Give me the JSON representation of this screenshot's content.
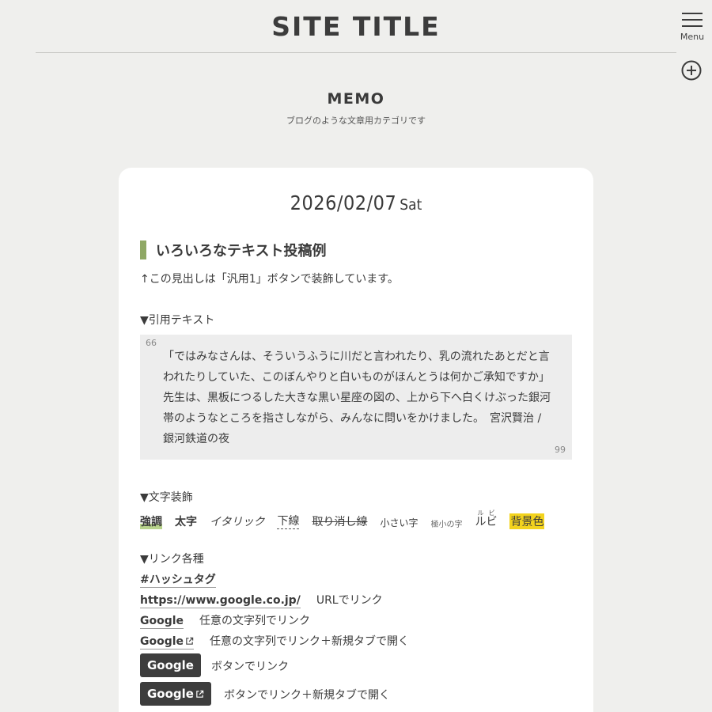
{
  "header": {
    "site_title": "SITE TITLE",
    "menu_label": "Menu"
  },
  "category": {
    "name": "MEMO",
    "description": "ブログのような文章用カテゴリです"
  },
  "post": {
    "date": "2026/02/07",
    "weekday": "Sat",
    "heading": "いろいろなテキスト投稿例",
    "heading_note": "↑この見出しは「汎用1」ボタンで装飾しています。",
    "quote_section_label": "▼引用テキスト",
    "quote_text": "「ではみなさんは、そういうふうに川だと言われたり、乳の流れたあとだと言われたりしていた、このぼんやりと白いものがほんとうは何かご承知ですか」先生は、黒板につるした大きな黒い星座の図の、上から下へ白くけぶった銀河帯のようなところを指さしながら、みんなに問いをかけました。　宮沢賢治 / 銀河鉄道の夜",
    "quote_open_mark": "66",
    "quote_close_mark": "99",
    "decoration_section_label": "▼文字装飾",
    "decorations": {
      "strong": "強調",
      "bold": "太字",
      "italic": "イタリック",
      "underline": "下線",
      "strike": "取り消し線",
      "small": "小さい字",
      "xsmall": "極小の字",
      "ruby_base": "ルビ",
      "ruby_text": "ルビ",
      "background": "背景色"
    },
    "link_section_label": "▼リンク各種",
    "links": {
      "hashtag": "#ハッシュタグ",
      "url": "https://www.google.co.jp/",
      "url_note": "URLでリンク",
      "text_link": "Google",
      "text_link_note": "任意の文字列でリンク",
      "text_link_newtab": "Google",
      "text_link_newtab_note": "任意の文字列でリンク＋新規タブで開く",
      "button": "Google",
      "button_note": "ボタンでリンク",
      "button_newtab": "Google",
      "button_newtab_note": "ボタンでリンク＋新規タブで開く"
    }
  }
}
